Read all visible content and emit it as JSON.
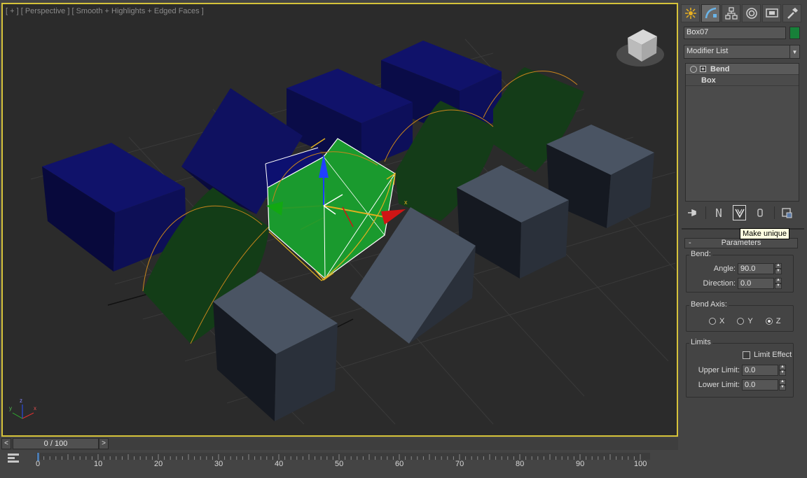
{
  "viewport": {
    "label": "[ + ] [ Perspective ] [ Smooth + Highlights + Edged Faces ]",
    "axis_labels": [
      "z",
      "y",
      "x"
    ],
    "gizmo_label": "x"
  },
  "command_panel": {
    "tabs": [
      {
        "icon": "create-icon"
      },
      {
        "icon": "modify-icon"
      },
      {
        "icon": "hierarchy-icon"
      },
      {
        "icon": "motion-icon"
      },
      {
        "icon": "display-icon"
      },
      {
        "icon": "utilities-icon"
      }
    ],
    "object_name": "Box07",
    "object_color": "#178039",
    "modifier_list": "Modifier List",
    "stack": [
      {
        "label": "Bend"
      },
      {
        "label": "Box"
      }
    ],
    "stack_tools": [
      "pin-stack-icon",
      "show-end-result-icon",
      "make-unique-icon",
      "remove-modifier-icon",
      "configure-modifier-sets-icon"
    ],
    "tooltip": "Make unique"
  },
  "parameters": {
    "title": "Parameters",
    "collapse_symbol": "-",
    "bend": {
      "title": "Bend:",
      "angle_label": "Angle:",
      "angle_value": "90.0",
      "direction_label": "Direction:",
      "direction_value": "0.0"
    },
    "bend_axis": {
      "title": "Bend Axis:",
      "options": [
        "X",
        "Y",
        "Z"
      ],
      "selected": "Z"
    },
    "limits": {
      "title": "Limits",
      "limit_effect_label": "Limit Effect",
      "limit_effect_checked": false,
      "upper_label": "Upper Limit:",
      "upper_value": "0.0",
      "lower_label": "Lower Limit:",
      "lower_value": "0.0"
    }
  },
  "timeline": {
    "prev": "<",
    "next": ">",
    "slider_text": "0 / 100",
    "ticks": [
      "0",
      "10",
      "20",
      "30",
      "40",
      "50",
      "60",
      "70",
      "80",
      "90",
      "100"
    ]
  }
}
